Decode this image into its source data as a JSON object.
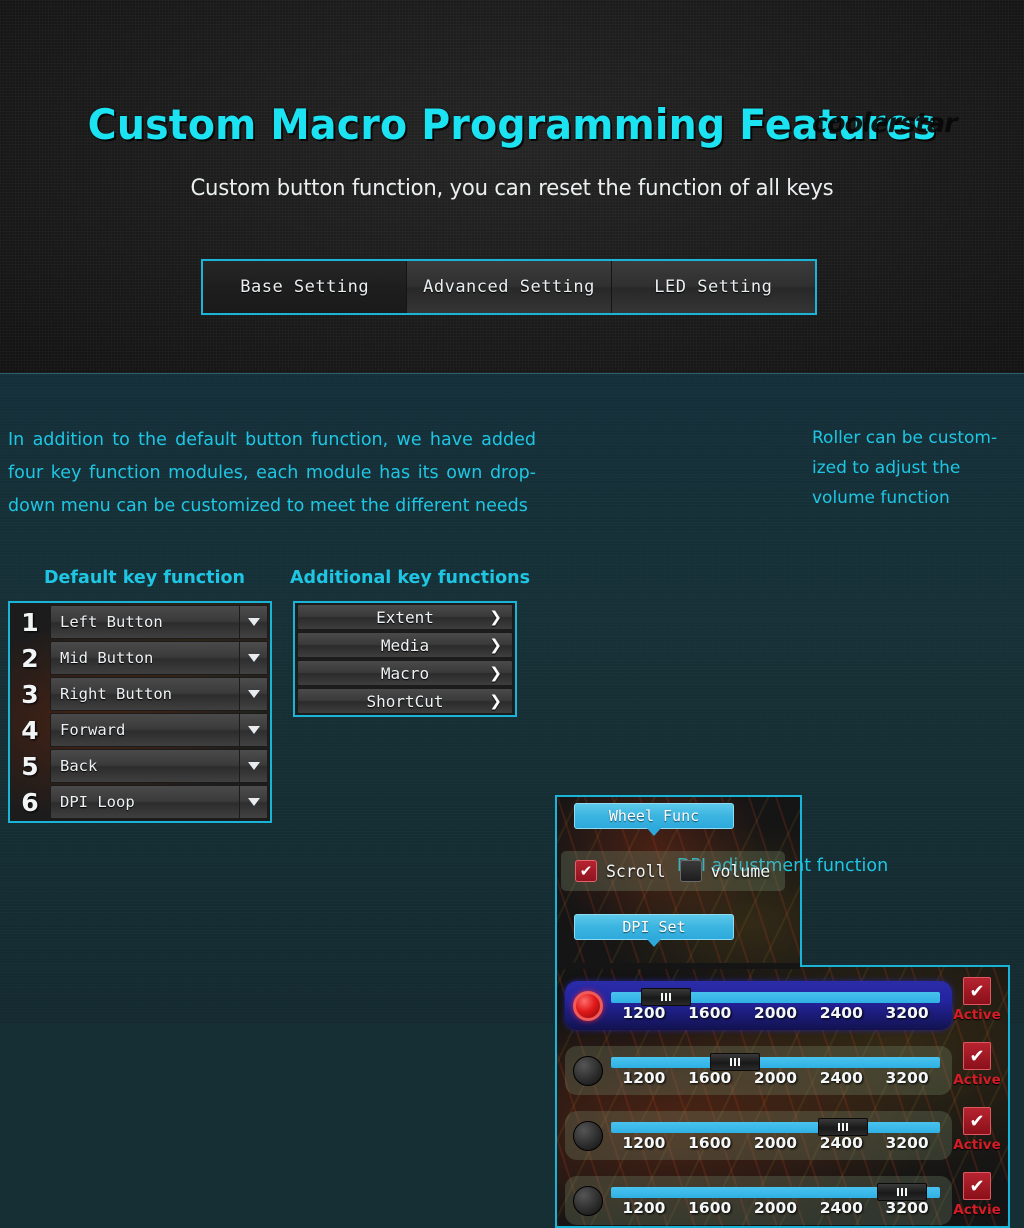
{
  "hero": {
    "title": "Custom Macro Programming Features",
    "subtitle": "Custom button function, you can reset the function of all keys",
    "watermark": "coolerstar"
  },
  "tabs": [
    {
      "label": "Base Setting",
      "active": true
    },
    {
      "label": "Advanced Setting",
      "active": false
    },
    {
      "label": "LED Setting",
      "active": false
    }
  ],
  "lower": {
    "intro": "In addition to the default button function, we have added four key function modules, each module has its own drop-down menu can be customized to meet the different needs",
    "roller_note": "Roller can be custom-ized to adjust the volume function",
    "default_key_title": "Default key function",
    "additional_key_title": "Additional key functions",
    "dpi_caption": "DPI adjustment function"
  },
  "default_keys": [
    {
      "index": "1",
      "label": "Left Button",
      "icon": "chevron-down-icon"
    },
    {
      "index": "2",
      "label": "Mid Button",
      "icon": "chevron-down-icon"
    },
    {
      "index": "3",
      "label": "Right Button",
      "icon": "chevron-down-icon"
    },
    {
      "index": "4",
      "label": "Forward",
      "icon": "chevron-down-icon"
    },
    {
      "index": "5",
      "label": "Back",
      "icon": "chevron-down-icon"
    },
    {
      "index": "6",
      "label": "DPI Loop",
      "icon": "chevron-down-icon"
    }
  ],
  "additional_keys": [
    {
      "label": "Extent",
      "icon": "chevron-right-icon",
      "chevron": "❯"
    },
    {
      "label": "Media",
      "icon": "chevron-right-icon",
      "chevron": "❯"
    },
    {
      "label": "Macro",
      "icon": "chevron-right-icon",
      "chevron": "❯"
    },
    {
      "label": "ShortCut",
      "icon": "chevron-right-icon",
      "chevron": "❯"
    }
  ],
  "wheel_func": {
    "bubble_label": "Wheel Func",
    "options": [
      {
        "label": "Scroll",
        "checked": true,
        "mark": "✔"
      },
      {
        "label": "volume",
        "checked": false,
        "mark": ""
      }
    ]
  },
  "dpi_set": {
    "bubble_label": "DPI Set",
    "ticks": [
      "1200",
      "1600",
      "2000",
      "2400",
      "3200"
    ],
    "rows": [
      {
        "led_on": true,
        "selected": true,
        "handle_pct": 9,
        "value": "1200",
        "active_label": "Active",
        "active_mark": "✔"
      },
      {
        "led_on": false,
        "selected": false,
        "handle_pct": 30,
        "value": "1600",
        "active_label": "Active",
        "active_mark": "✔"
      },
      {
        "led_on": false,
        "selected": false,
        "handle_pct": 63,
        "value": "2400",
        "active_label": "Active",
        "active_mark": "✔"
      },
      {
        "led_on": false,
        "selected": false,
        "handle_pct": 81,
        "value": "3200",
        "active_label": "Actvie",
        "active_mark": "✔"
      }
    ]
  },
  "colors": {
    "accent_cyan": "#1ab4d8",
    "text_cyan": "#1fc6e4",
    "title_cyan": "#1ce3f2",
    "slider_blue": "#2fb0e4",
    "active_red": "#d41d26",
    "selected_row_blue": "#2424a0",
    "hero_bg": "#1b1b1b",
    "lower_bg": "#163137"
  }
}
